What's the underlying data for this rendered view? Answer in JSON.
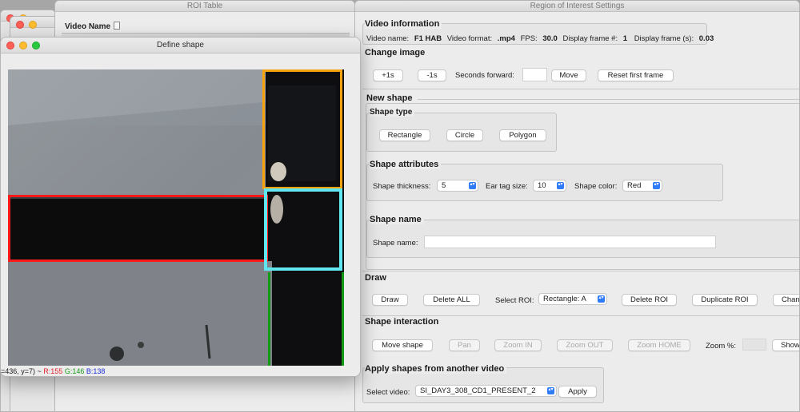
{
  "roi_table": {
    "title": "ROI Table",
    "column_header": "Video Name"
  },
  "roi_settings": {
    "title": "Region of Interest Settings",
    "video_info": {
      "heading": "Video information",
      "name_label": "Video name:",
      "name_value": "F1 HAB",
      "format_label": "Video format:",
      "format_value": ".mp4",
      "fps_label": "FPS:",
      "fps_value": "30.0",
      "frame_label": "Display frame #:",
      "frame_value": "1",
      "frame_s_label": "Display frame (s):",
      "frame_s_value": "0.03"
    },
    "change_image": {
      "heading": "Change image",
      "plus_label": "+1s",
      "minus_label": "-1s",
      "seconds_label": "Seconds forward:",
      "seconds_value": "",
      "move_label": "Move",
      "reset_label": "Reset first frame"
    },
    "new_shape": {
      "heading": "New shape",
      "shape_type": {
        "heading": "Shape type",
        "rectangle": "Rectangle",
        "circle": "Circle",
        "polygon": "Polygon"
      },
      "attributes": {
        "heading": "Shape attributes",
        "thickness_label": "Shape thickness:",
        "thickness_value": "5",
        "ear_label": "Ear tag size:",
        "ear_value": "10",
        "color_label": "Shape color:",
        "color_value": "Red"
      },
      "name": {
        "heading": "Shape name",
        "label": "Shape name:",
        "value": ""
      }
    },
    "draw": {
      "heading": "Draw",
      "draw_label": "Draw",
      "delete_all_label": "Delete ALL",
      "select_roi_label": "Select ROI:",
      "select_roi_value": "Rectangle: A",
      "delete_roi_label": "Delete ROI",
      "duplicate_label": "Duplicate ROI",
      "change_label": "Chang"
    },
    "interaction": {
      "heading": "Shape interaction",
      "move_label": "Move shape",
      "pan_label": "Pan",
      "zoom_in_label": "Zoom IN",
      "zoom_out_label": "Zoom OUT",
      "zoom_home_label": "Zoom HOME",
      "zoom_pct_label": "Zoom %:",
      "show_label": "Show"
    },
    "apply": {
      "heading": "Apply shapes from another video",
      "select_label": "Select video:",
      "select_value": "SI_DAY3_308_CD1_PRESENT_2",
      "apply_label": "Apply"
    }
  },
  "define_shape": {
    "title": "Define shape",
    "status_prefix": "=436, y=7) ~ ",
    "status_r": "R:155",
    "status_g": "G:146",
    "status_b": "B:138"
  },
  "colors": {
    "roi_red": "#ff1a1a",
    "roi_orange": "#f5a20e",
    "roi_cyan": "#5fe6ee",
    "roi_green": "#139a14",
    "status_r": "#e0202a",
    "status_g": "#1a9a1a",
    "status_b": "#1f2fd6",
    "select_accent": "#2f7cf6"
  },
  "icons": [
    "document-icon",
    "close-light-icon",
    "minimize-light-icon",
    "zoom-light-icon",
    "chevron-updown-icon"
  ]
}
